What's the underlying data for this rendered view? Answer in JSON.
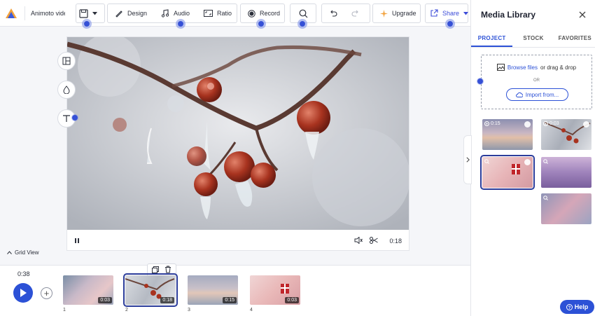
{
  "toolbar": {
    "project_title": "Animoto video",
    "design": "Design",
    "audio": "Audio",
    "ratio": "Ratio",
    "record": "Record",
    "upgrade": "Upgrade",
    "share": "Share"
  },
  "player": {
    "time": "0:18"
  },
  "grid_view": "Grid View",
  "timeline": {
    "duration": "0:38",
    "clips": [
      {
        "number": "1",
        "time": "0:03"
      },
      {
        "number": "2",
        "time": "0:18"
      },
      {
        "number": "3",
        "time": "0:15"
      },
      {
        "number": "4",
        "time": "0:03"
      }
    ]
  },
  "media_library": {
    "title": "Media Library",
    "tabs": [
      "PROJECT",
      "STOCK",
      "FAVORITES"
    ],
    "active_tab": "PROJECT",
    "browse_link": "Browse files",
    "drag_text": "or drag & drop",
    "or_text": "OR",
    "import_button": "Import from...",
    "thumbnails": [
      {
        "label": "0:15"
      },
      {
        "label": "0:03"
      }
    ]
  },
  "help": "Help",
  "colors": {
    "accent": "#2c51d6",
    "selection": "#2c3d9b"
  }
}
